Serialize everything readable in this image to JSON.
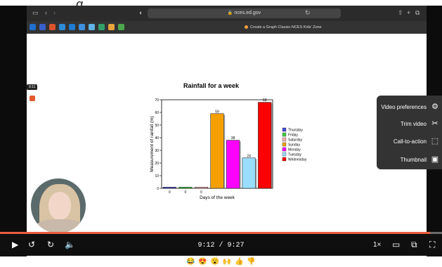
{
  "page_title_fragment": "g",
  "browser": {
    "url": "nces.ed.gov",
    "active_tab_label": "Create a Graph Classic-NCES Kids' Zone"
  },
  "overlay": {
    "timestamp_badge": "9:11"
  },
  "chart_data": {
    "type": "bar",
    "title": "Rainfall for a week",
    "xlabel": "Days of the week",
    "ylabel": "Measurement of rainfall (m)",
    "ylim": [
      0,
      70
    ],
    "yticks": [
      "0",
      "10",
      "20",
      "30",
      "40",
      "50",
      "60",
      "70"
    ],
    "categories": [
      "Thursday",
      "Friday",
      "Saturday",
      "Sunday",
      "Monday",
      "Tuesday",
      "Wednesday"
    ],
    "values": [
      0,
      0,
      0,
      59,
      38,
      24,
      68
    ],
    "value_labels": [
      "0",
      "0",
      "0",
      "59",
      "38",
      "24",
      "68"
    ],
    "colors": [
      "#4b4bd6",
      "#44cc44",
      "#f5b3b3",
      "#f5a000",
      "#ff00ff",
      "#99ddff",
      "#ff0000"
    ],
    "legend_position": "right",
    "grid": false
  },
  "menu": {
    "items": [
      {
        "label": "Video preferences",
        "icon": "sliders-icon"
      },
      {
        "label": "Trim video",
        "icon": "scissors-icon"
      },
      {
        "label": "Call-to-action",
        "icon": "cursor-box-icon"
      },
      {
        "label": "Thumbnail",
        "icon": "image-icon"
      }
    ]
  },
  "player": {
    "time_display": "9:12 / 9:27",
    "progress_fraction": 0.973,
    "speed_label": "1×"
  },
  "reactions": [
    "😂",
    "😍",
    "😮",
    "🙌",
    "👍",
    "👎"
  ]
}
